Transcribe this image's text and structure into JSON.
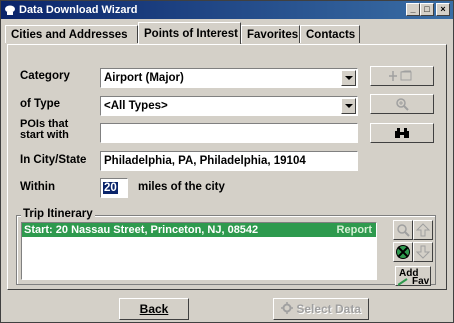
{
  "window": {
    "title": "Data Download Wizard",
    "minimize_label": "_",
    "maximize_label": "□",
    "close_label": "×"
  },
  "tabs": [
    {
      "label": "Cities and Addresses",
      "active": false
    },
    {
      "label": "Points of Interest",
      "active": true
    },
    {
      "label": "Favorites",
      "active": false
    },
    {
      "label": "Contacts",
      "active": false
    }
  ],
  "form": {
    "category_label": "Category",
    "category_value": "Airport (Major)",
    "type_label": "of Type",
    "type_value": "<All Types>",
    "pois_label_line1": "POIs that",
    "pois_label_line2": "start with",
    "pois_value": "",
    "city_label": "In City/State",
    "city_value": "Philadelphia, PA, Philadelphia, 19104",
    "within_label": "Within",
    "within_value": "20",
    "within_units": "miles of the city"
  },
  "side_buttons": {
    "add_icon": "add-to-itinerary-icon",
    "zoom_icon": "zoom-icon",
    "find_icon": "binoculars-icon"
  },
  "itinerary": {
    "group_label": "Trip Itinerary",
    "rows": [
      {
        "text": "Start: 20 Nassau Street, Princeton, NJ, 08542",
        "report": "Report"
      }
    ],
    "add_fav_line1": "Add",
    "add_fav_line2": "Fav"
  },
  "bottom": {
    "back_label": "Back",
    "select_data_label": "Select Data"
  },
  "colors": {
    "titlebar_start": "#0a246a",
    "titlebar_end": "#3a6ea5",
    "itinerary_selected": "#2e9a4e",
    "face": "#d4d0c8"
  }
}
